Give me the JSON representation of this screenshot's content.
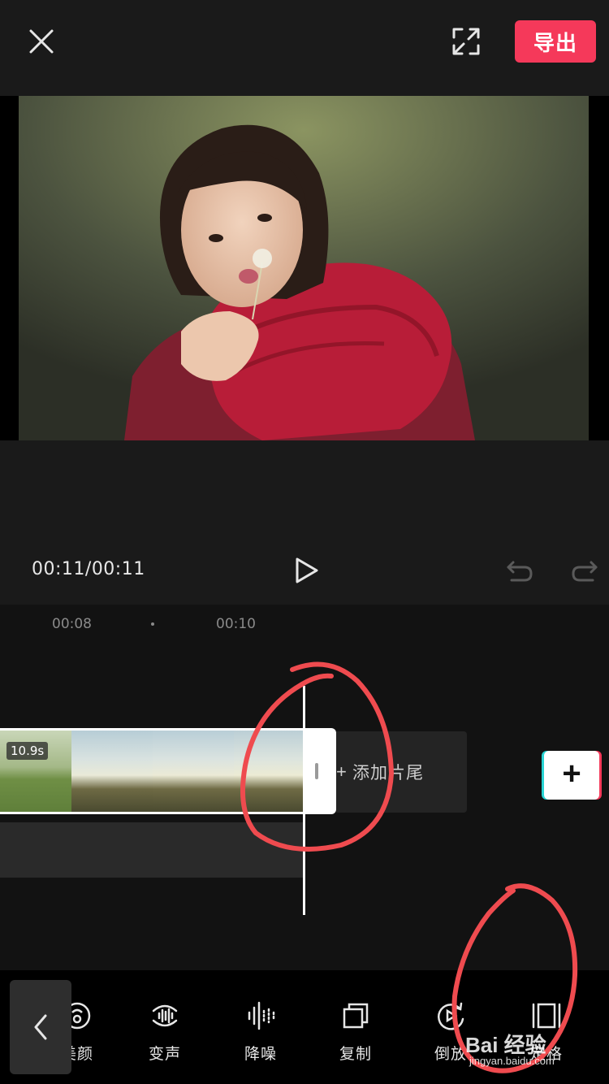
{
  "header": {
    "export_label": "导出",
    "close_icon": "close-icon",
    "fullscreen_icon": "fullscreen-icon"
  },
  "player": {
    "timecode": "00:11/00:11",
    "play_icon": "play-icon",
    "undo_icon": "undo-icon",
    "redo_icon": "redo-icon"
  },
  "timeline": {
    "ruler_marks": [
      "00:08",
      "00:10"
    ],
    "clip_duration": "10.9s",
    "add_ending_plus": "+",
    "add_ending_label": "添加片尾",
    "add_clip_symbol": "+"
  },
  "toolbar": {
    "back_icon": "chevron-left-icon",
    "items": [
      {
        "label": "美颜",
        "icon": "beauty-icon"
      },
      {
        "label": "变声",
        "icon": "voice-change-icon"
      },
      {
        "label": "降噪",
        "icon": "noise-reduction-icon"
      },
      {
        "label": "复制",
        "icon": "copy-icon"
      },
      {
        "label": "倒放",
        "icon": "reverse-icon"
      },
      {
        "label": "定格",
        "icon": "freeze-frame-icon"
      }
    ]
  },
  "watermark": {
    "brand": "Bai 经验",
    "url": "jingyan.baidu.com"
  },
  "colors": {
    "accent": "#f5395a",
    "background": "#1a1a1a",
    "timeline_bg": "#121212",
    "annotation": "#ef4b4f"
  }
}
